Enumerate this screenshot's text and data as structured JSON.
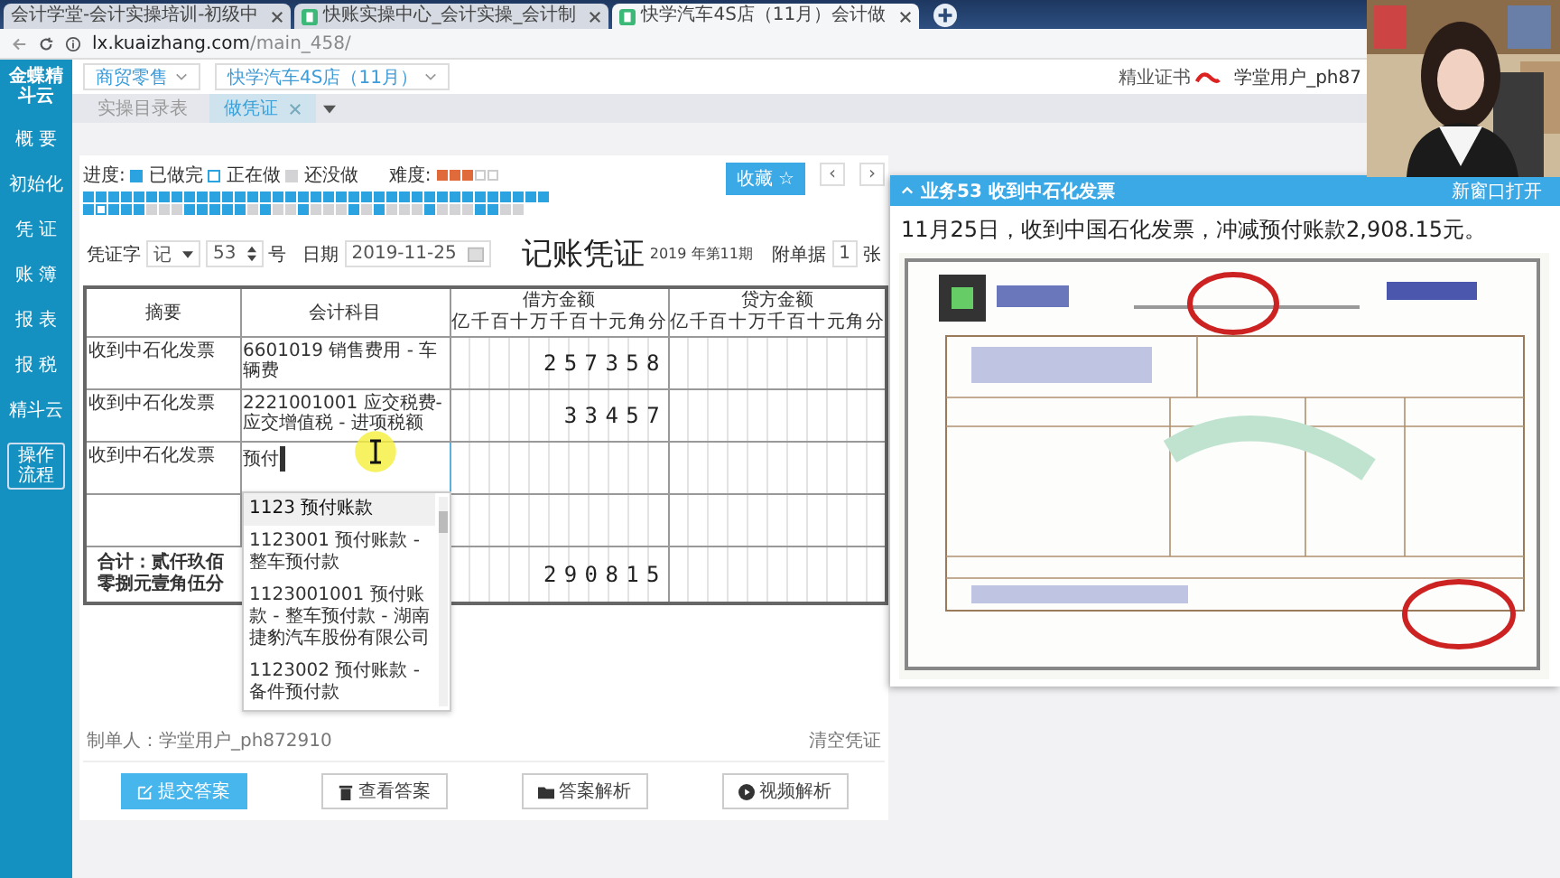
{
  "browser": {
    "tabs": [
      {
        "title": "会计学堂-会计实操培训-初级中",
        "selected": false
      },
      {
        "title": "快账实操中心_会计实操_会计制",
        "selected": false
      },
      {
        "title": "快学汽车4S店（11月）会计做",
        "selected": true
      }
    ],
    "url_host": "lx.kuaizhang.com",
    "url_path": "/main_458/"
  },
  "sidebar": {
    "logo": "金蝶精斗云",
    "items": [
      {
        "label": "概 要"
      },
      {
        "label": "初始化"
      },
      {
        "label": "凭 证"
      },
      {
        "label": "账 簿"
      },
      {
        "label": "报 表"
      },
      {
        "label": "报 税"
      },
      {
        "label": "精斗云"
      }
    ],
    "flow_button": "操作流程"
  },
  "topbar": {
    "industry": "商贸零售",
    "company": "快学汽车4S店（11月）",
    "certificate": "精业证书",
    "user": "学堂用户_ph87"
  },
  "page_tabs": [
    {
      "label": "实操目录表",
      "selected": false,
      "closable": false
    },
    {
      "label": "做凭证",
      "selected": true,
      "closable": true
    }
  ],
  "progress": {
    "label": "进度:",
    "legend": [
      {
        "kind": "done",
        "label": "已做完"
      },
      {
        "kind": "current",
        "label": "正在做"
      },
      {
        "kind": "todo",
        "label": "还没做"
      }
    ],
    "difficulty_label": "难度:",
    "stars": 3,
    "rows": [
      [
        {
          "kind": "done"
        },
        {
          "kind": "done"
        },
        {
          "kind": "done"
        },
        {
          "kind": "done"
        },
        {
          "kind": "done"
        },
        {
          "kind": "done"
        },
        {
          "kind": "done"
        },
        {
          "kind": "done"
        },
        {
          "kind": "done"
        },
        {
          "kind": "done"
        },
        {
          "kind": "done"
        },
        {
          "kind": "done"
        },
        {
          "kind": "done"
        },
        {
          "kind": "done"
        },
        {
          "kind": "done"
        },
        {
          "kind": "done"
        },
        {
          "kind": "done"
        },
        {
          "kind": "done"
        },
        {
          "kind": "done"
        },
        {
          "kind": "done"
        },
        {
          "kind": "done"
        },
        {
          "kind": "done"
        },
        {
          "kind": "done"
        },
        {
          "kind": "done"
        },
        {
          "kind": "done"
        },
        {
          "kind": "done"
        },
        {
          "kind": "done"
        },
        {
          "kind": "done"
        },
        {
          "kind": "done"
        },
        {
          "kind": "done"
        },
        {
          "kind": "done"
        },
        {
          "kind": "done"
        },
        {
          "kind": "done"
        },
        {
          "kind": "done"
        },
        {
          "kind": "done"
        },
        {
          "kind": "done"
        },
        {
          "kind": "done"
        }
      ],
      [
        {
          "kind": "done"
        },
        {
          "kind": "current"
        },
        {
          "kind": "done"
        },
        {
          "kind": "done"
        },
        {
          "kind": "done"
        },
        {
          "kind": "todo"
        },
        {
          "kind": "todo"
        },
        {
          "kind": "todo"
        },
        {
          "kind": "done"
        },
        {
          "kind": "done"
        },
        {
          "kind": "done"
        },
        {
          "kind": "done"
        },
        {
          "kind": "done"
        },
        {
          "kind": "todo"
        },
        {
          "kind": "done"
        },
        {
          "kind": "todo"
        },
        {
          "kind": "todo"
        },
        {
          "kind": "done"
        },
        {
          "kind": "todo"
        },
        {
          "kind": "todo"
        },
        {
          "kind": "todo"
        },
        {
          "kind": "done"
        },
        {
          "kind": "todo"
        },
        {
          "kind": "done"
        },
        {
          "kind": "todo"
        },
        {
          "kind": "todo"
        },
        {
          "kind": "todo"
        },
        {
          "kind": "done"
        },
        {
          "kind": "todo"
        },
        {
          "kind": "todo"
        },
        {
          "kind": "todo"
        },
        {
          "kind": "done"
        },
        {
          "kind": "done"
        },
        {
          "kind": "todo"
        },
        {
          "kind": "todo"
        }
      ]
    ]
  },
  "favorite_button": "收藏 ☆",
  "nav": [
    "‹",
    "›"
  ],
  "voucher": {
    "word_label": "凭证字",
    "word": "记",
    "number": "53",
    "number_suffix": "号",
    "date_label": "日期",
    "date": "2019-11-25",
    "title": "记账凭证",
    "period": "2019 年第11期",
    "attach_label": "附单据",
    "attach_count": "1",
    "attach_suffix": "张",
    "columns": {
      "summary": "摘要",
      "account": "会计科目",
      "debit": "借方金额",
      "credit": "贷方金额",
      "debit_digits": [
        "亿",
        "千",
        "百",
        "十",
        "万",
        "千",
        "百",
        "十",
        "元",
        "角",
        "分"
      ],
      "credit_digits": [
        "亿",
        "千",
        "百",
        "十",
        "万",
        "千",
        "百",
        "十",
        "元",
        "角",
        "分"
      ]
    },
    "rows": [
      {
        "kind": "entry",
        "summary": "收到中石化发票",
        "account": "6601019 销售费用 - 车辆费",
        "debit": "257358"
      },
      {
        "kind": "entry",
        "summary": "收到中石化发票",
        "account": "2221001001 应交税费-应交增值税 - 进项税额",
        "debit": "33457"
      },
      {
        "kind": "input",
        "summary": "收到中石化发票",
        "account": "预付"
      },
      {
        "kind": "blank"
      }
    ],
    "total": {
      "label": "合计：贰仟玖佰零捌元壹角伍分",
      "debit": "290815"
    },
    "suggestions": [
      {
        "text": "1123 预付账款",
        "selected": true
      },
      {
        "text": "1123001 预付账款 - 整车预付款",
        "selected": false
      },
      {
        "text": "1123001001 预付账款 - 整车预付款 - 湖南捷豹汽车股份有限公司",
        "selected": false
      },
      {
        "text": "1123002 预付账款 - 备件预付款",
        "selected": false
      }
    ],
    "maker": "制单人：学堂用户_ph872910",
    "clear": "清空凭证"
  },
  "actions": [
    {
      "kind": "edit",
      "label": "提交答案",
      "primary": true
    },
    {
      "kind": "trash",
      "label": "查看答案",
      "primary": false
    },
    {
      "kind": "folder",
      "label": "答案解析",
      "primary": false
    },
    {
      "kind": "play",
      "label": "视频解析",
      "primary": false
    }
  ],
  "task_panel": {
    "title": "业务53 收到中石化发票",
    "open_new": "新窗口打开",
    "description": "11月25日，收到中国石化发票，冲减预付账款2,908.15元。",
    "attachment": {
      "kind": "picture"
    }
  },
  "webcam": {
    "kind": "picture"
  }
}
